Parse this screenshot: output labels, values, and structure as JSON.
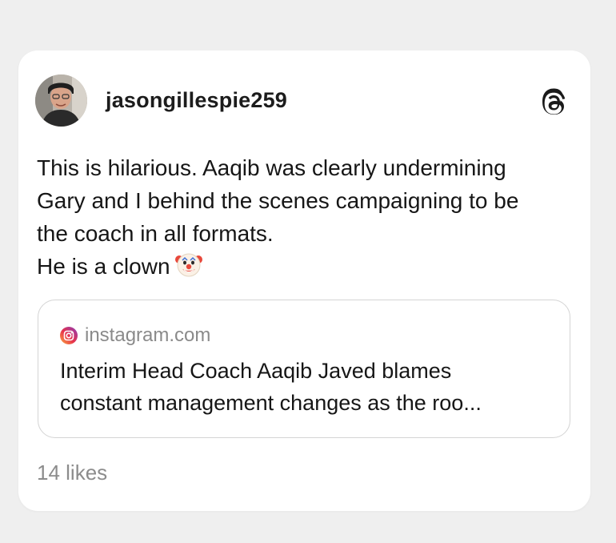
{
  "post": {
    "username": "jasongillespie259",
    "avatar_icon": "profile-photo",
    "platform_icon": "threads-logo-icon",
    "text_lines": [
      "This is hilarious. Aaqib was clearly undermining",
      "Gary and I behind the scenes campaigning to be",
      "the coach in all formats.",
      "He is a clown"
    ],
    "emoji": "clown-face-icon",
    "link_preview": {
      "source_icon": "instagram-icon",
      "source": "instagram.com",
      "title_lines": [
        "Interim Head Coach Aaqib Javed blames",
        "constant management changes as the roo..."
      ]
    },
    "likes": "14 likes"
  },
  "colors": {
    "background": "#efefef",
    "card": "#ffffff",
    "text": "#161616",
    "muted": "#8a8a8a",
    "border": "#d4d4d4"
  }
}
